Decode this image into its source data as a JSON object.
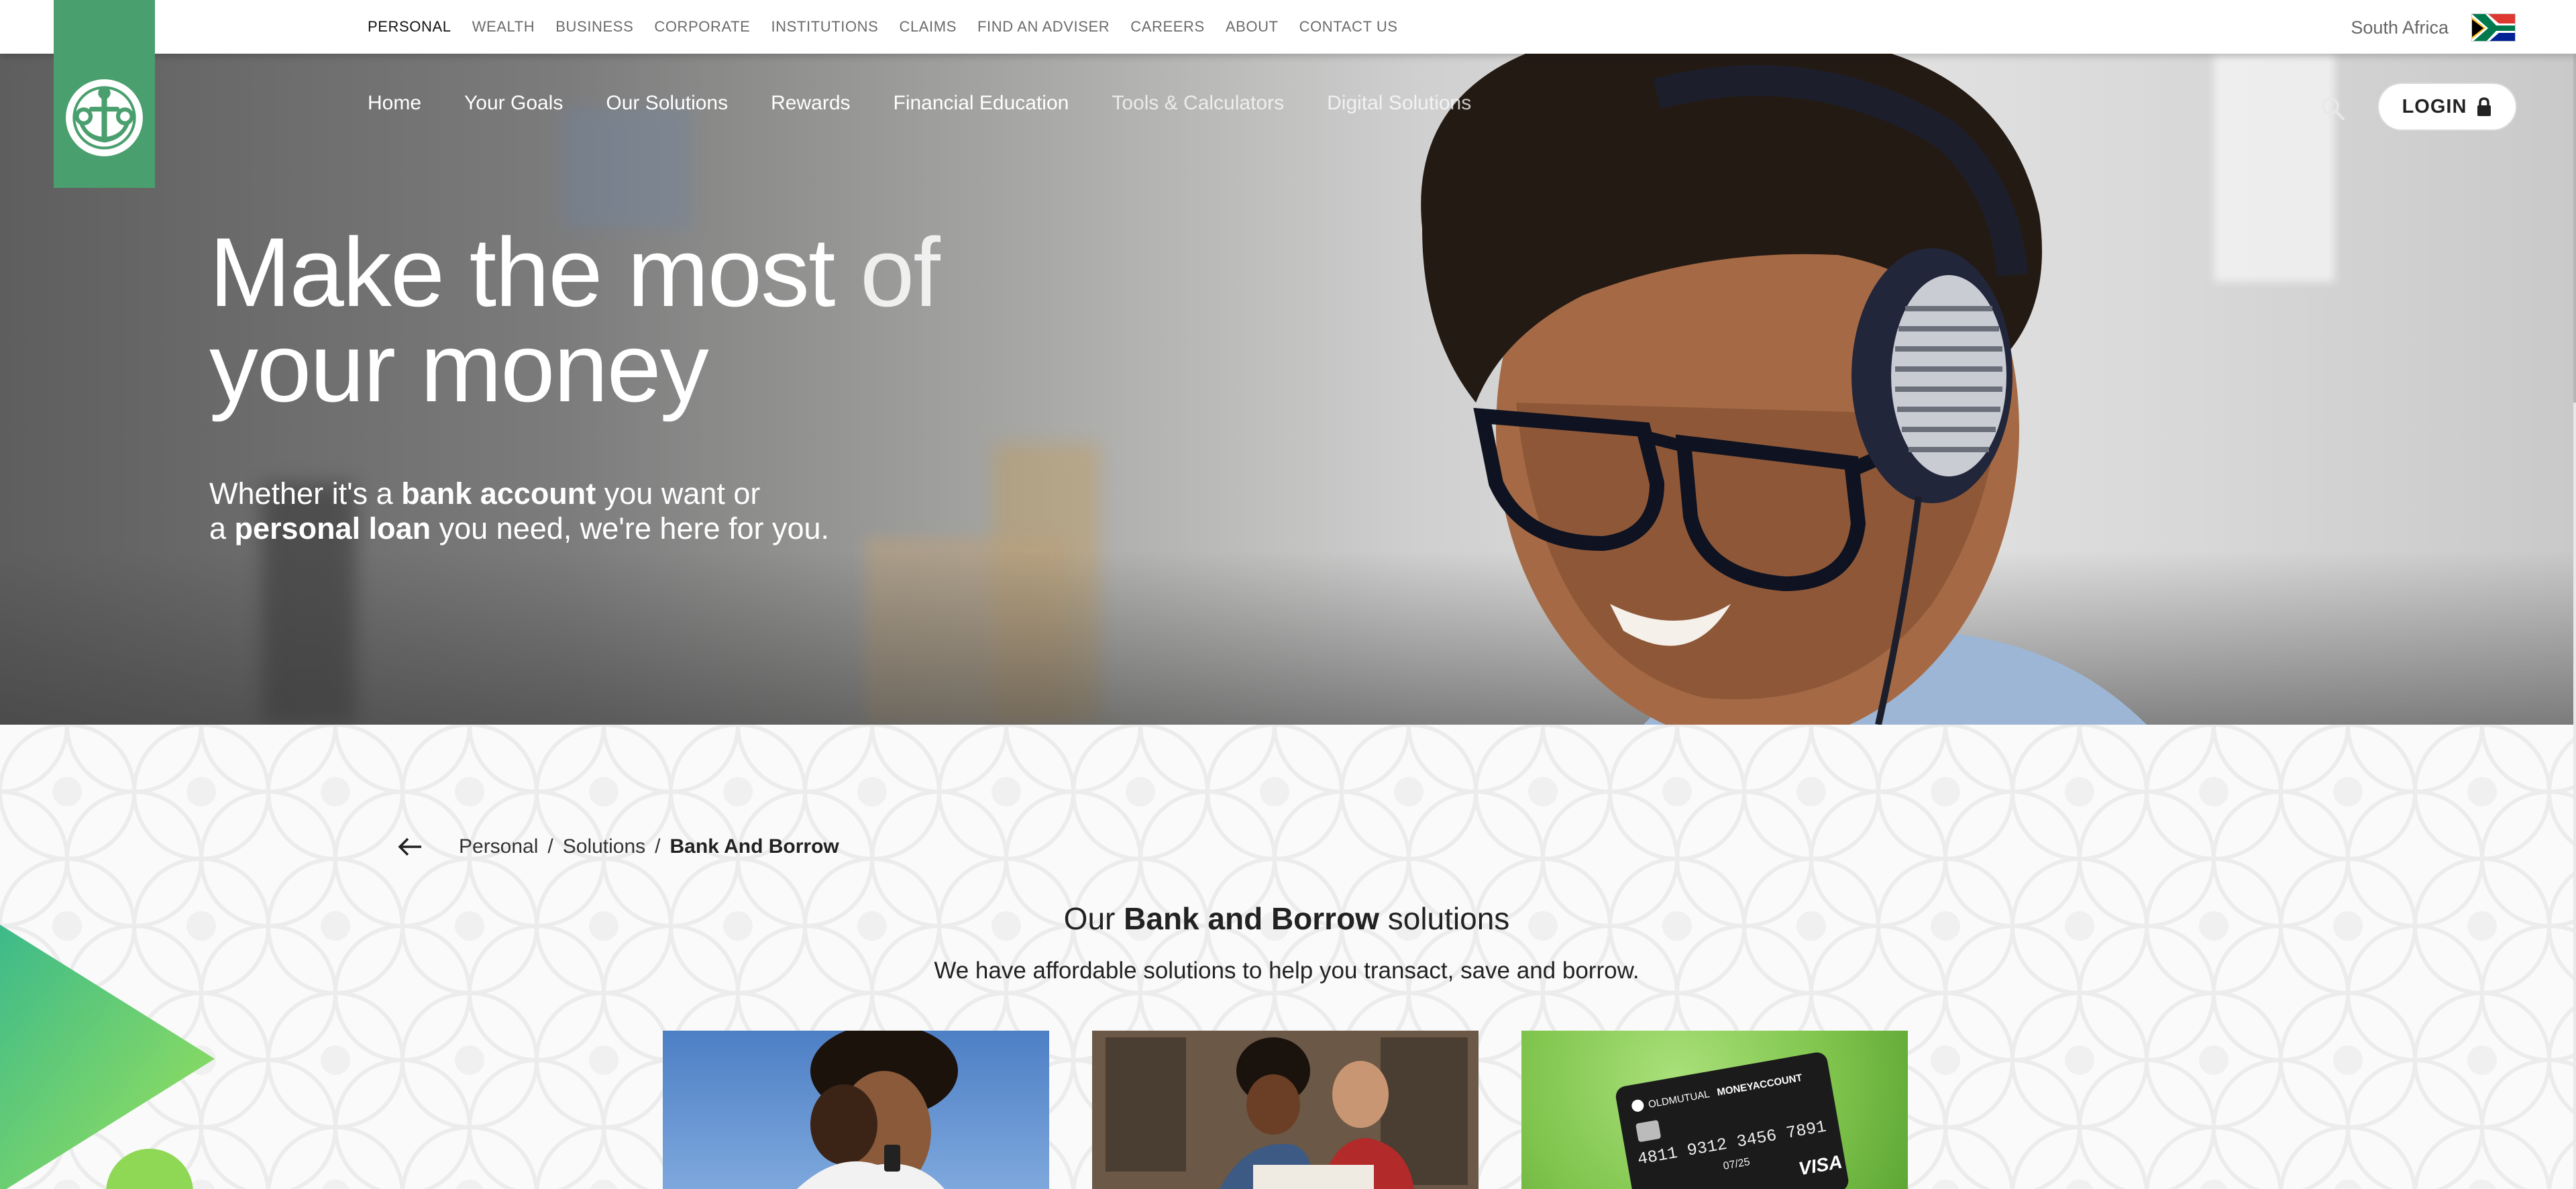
{
  "topbar": {
    "nav": [
      "PERSONAL",
      "WEALTH",
      "BUSINESS",
      "CORPORATE",
      "INSTITUTIONS",
      "CLAIMS",
      "FIND AN ADVISER",
      "CAREERS",
      "ABOUT",
      "CONTACT US"
    ],
    "active": "PERSONAL",
    "region": "South Africa",
    "flag_icon": "south-africa-flag-icon"
  },
  "mainnav": {
    "items": [
      "Home",
      "Your Goals",
      "Our Solutions",
      "Rewards",
      "Financial Education",
      "Tools & Calculators",
      "Digital Solutions"
    ],
    "login_label": "LOGIN"
  },
  "hero": {
    "title_line1_a": "Make the most",
    "title_line1_b": " of",
    "title_line2": "your money",
    "sub_a": "Whether it's a ",
    "sub_b": "bank account",
    "sub_c": " you want or",
    "sub_d": "a ",
    "sub_e": "personal loan",
    "sub_f": " you need, we're here for you."
  },
  "breadcrumb": {
    "items": [
      "Personal",
      "Solutions"
    ],
    "current": "Bank And Borrow",
    "separator": "/"
  },
  "section": {
    "title_a": "Our ",
    "title_b": "Bank and Borrow",
    "title_c": " solutions",
    "description": "We have affordable solutions to help you transact, save and borrow."
  },
  "cards": [
    {
      "image": "couple-outdoors"
    },
    {
      "image": "workshop-couple"
    },
    {
      "image": "money-account-card",
      "card_text": {
        "brand": "OLDMUTUAL",
        "product": "MONEYACCOUNT",
        "number": "4811 9312 3456 7891",
        "expiry": "07/25",
        "network": "VISA"
      }
    }
  ],
  "colors": {
    "brand_green": "#4a9f6e",
    "accent_green": "#8ed856"
  }
}
